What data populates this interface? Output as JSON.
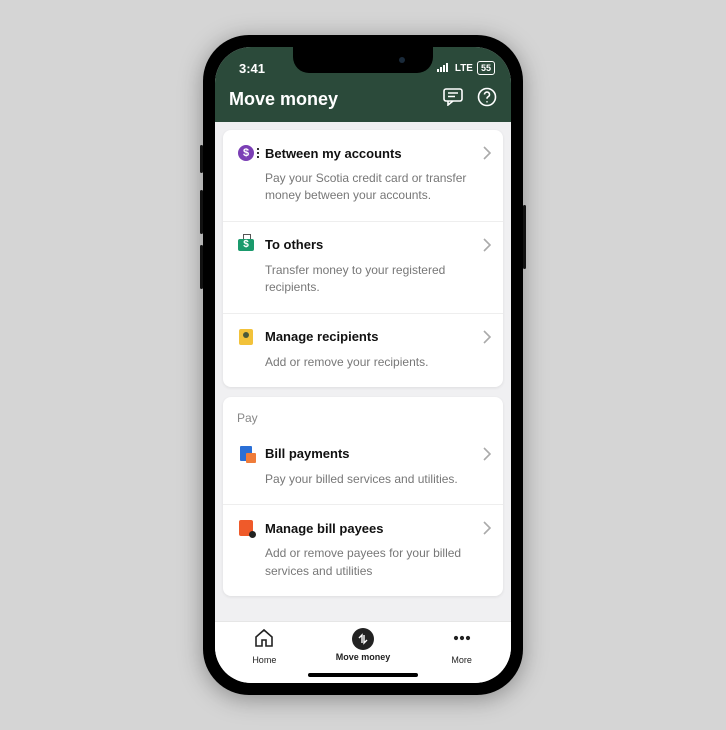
{
  "status": {
    "time": "3:41",
    "network": "LTE",
    "battery": "55"
  },
  "header": {
    "title": "Move money"
  },
  "sections": [
    {
      "rows": [
        {
          "icon": "between-accounts-icon",
          "title": "Between my accounts",
          "desc": "Pay your Scotia credit card or transfer money between your accounts."
        },
        {
          "icon": "to-others-icon",
          "title": "To others",
          "desc": "Transfer money to your registered recipients."
        },
        {
          "icon": "manage-recipients-icon",
          "title": "Manage recipients",
          "desc": "Add or remove your recipients."
        }
      ]
    },
    {
      "label": "Pay",
      "rows": [
        {
          "icon": "bill-payments-icon",
          "title": "Bill payments",
          "desc": "Pay your billed services and utilities."
        },
        {
          "icon": "manage-payees-icon",
          "title": "Manage bill payees",
          "desc": "Add or remove payees for your billed services and utilities"
        }
      ]
    }
  ],
  "tabs": {
    "home": "Home",
    "move": "Move money",
    "more": "More"
  }
}
